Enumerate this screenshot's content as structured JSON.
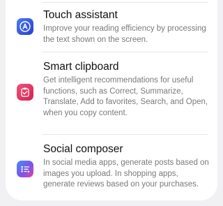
{
  "items": [
    {
      "title": "Touch assistant",
      "description": "Improve your reading efficiency by processing the text shown on the screen.",
      "icon": "touch-assistant-icon",
      "icon_color": "#3b5fe0"
    },
    {
      "title": "Smart clipboard",
      "description": "Get intelligent recommendations for useful functions, such as Correct, Summarize, Translate, Add to favorites, Search, and Open, when you copy content.",
      "icon": "smart-clipboard-icon",
      "icon_color": "#e0345d"
    },
    {
      "title": "Social composer",
      "description": "In social media apps, generate posts based on images you upload. In shopping apps, generate reviews based on your purchases.",
      "icon": "social-composer-icon",
      "icon_color": "#6a5ae8"
    }
  ]
}
